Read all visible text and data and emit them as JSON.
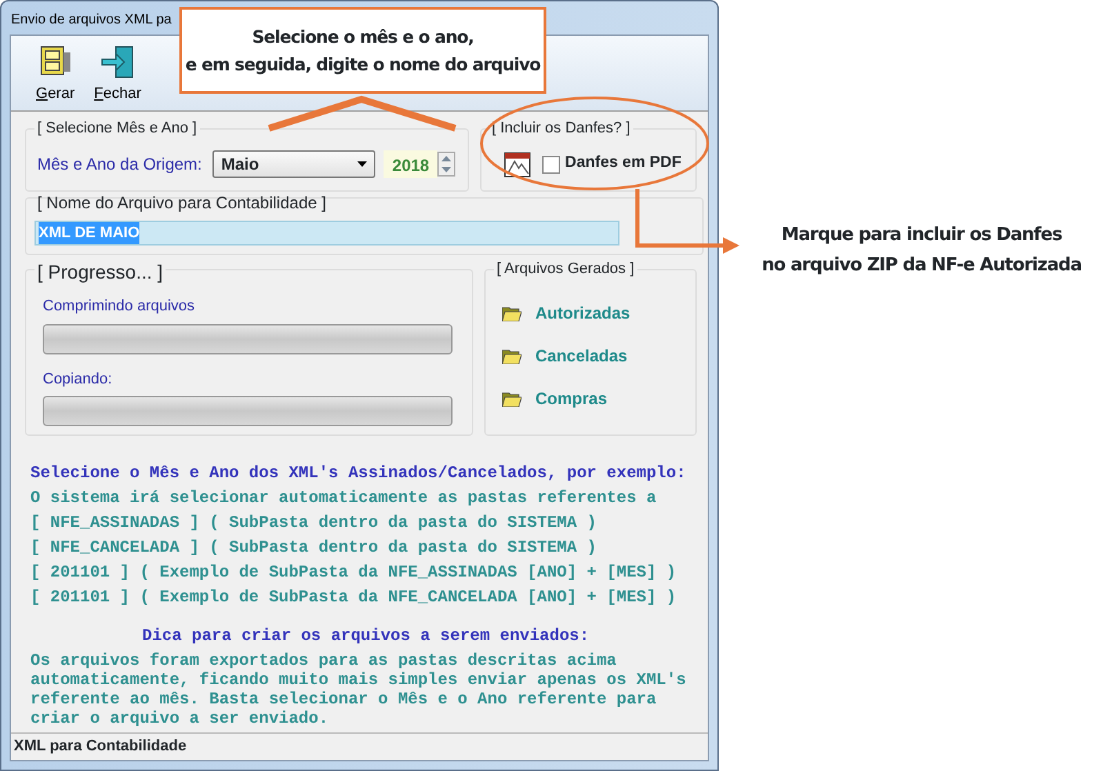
{
  "window": {
    "title": "Envio de arquivos XML pa"
  },
  "toolbar": {
    "buttons": [
      {
        "label": "Gerar",
        "kind": "generate"
      },
      {
        "label": "Fechar",
        "kind": "exit"
      }
    ]
  },
  "month_group": {
    "legend": "[ Selecione Mês e Ano ]",
    "label": "Mês e Ano da Origem:",
    "month": "Maio",
    "year": "2018"
  },
  "danfes_group": {
    "legend": "[ Incluir os Danfes? ]",
    "checkbox": {
      "label": "Danfes em PDF",
      "checked": false
    }
  },
  "filename_group": {
    "legend": "[ Nome do Arquivo para Contabilidade ]",
    "value": "XML DE MAIO",
    "text_selected": true
  },
  "progress_group": {
    "legend": "[ Progresso... ]",
    "bars": [
      {
        "label": "Comprimindo arquivos",
        "level": 0
      },
      {
        "label": "Copiando:",
        "level": 0
      }
    ]
  },
  "generated_group": {
    "legend": "[ Arquivos Gerados ]",
    "links": [
      "Autorizadas",
      "Canceladas",
      "Compras"
    ]
  },
  "info": [
    {
      "kind": "heading",
      "text": "Selecione o Mês e Ano dos XML's Assinados/Cancelados, por exemplo:"
    },
    {
      "kind": "line",
      "text": "O sistema irá selecionar automaticamente as pastas referentes a"
    },
    {
      "kind": "line",
      "text": "[ NFE_ASSINADAS ] ( SubPasta dentro da pasta do SISTEMA )"
    },
    {
      "kind": "line",
      "text": "[ NFE_CANCELADA ] ( SubPasta dentro da pasta do SISTEMA )"
    },
    {
      "kind": "line",
      "text": "[ 201101 ] ( Exemplo de SubPasta da NFE_ASSINADAS [ANO] + [MES] )"
    },
    {
      "kind": "line",
      "text": "[ 201101 ] ( Exemplo de SubPasta da NFE_CANCELADA [ANO] + [MES] )"
    },
    {
      "kind": "heading",
      "text": "Dica para criar os arquivos a serem enviados:"
    },
    {
      "kind": "paragraph",
      "text": "Os arquivos foram exportados para as pastas descritas acima automaticamente, ficando muito mais simples enviar apenas os XML's referente ao mês. Basta selecionar o Mês e o Ano referente para criar o arquivo a ser enviado."
    }
  ],
  "status_bar": "XML para Contabilidade",
  "callouts": [
    {
      "kind": "box",
      "lines": [
        "Selecione o mês e o ano,",
        "e em seguida, digite o nome do arquivo"
      ]
    },
    {
      "kind": "side",
      "lines": [
        "Marque para incluir os Danfes",
        "no arquivo ZIP da NF-e Autorizada"
      ]
    }
  ]
}
